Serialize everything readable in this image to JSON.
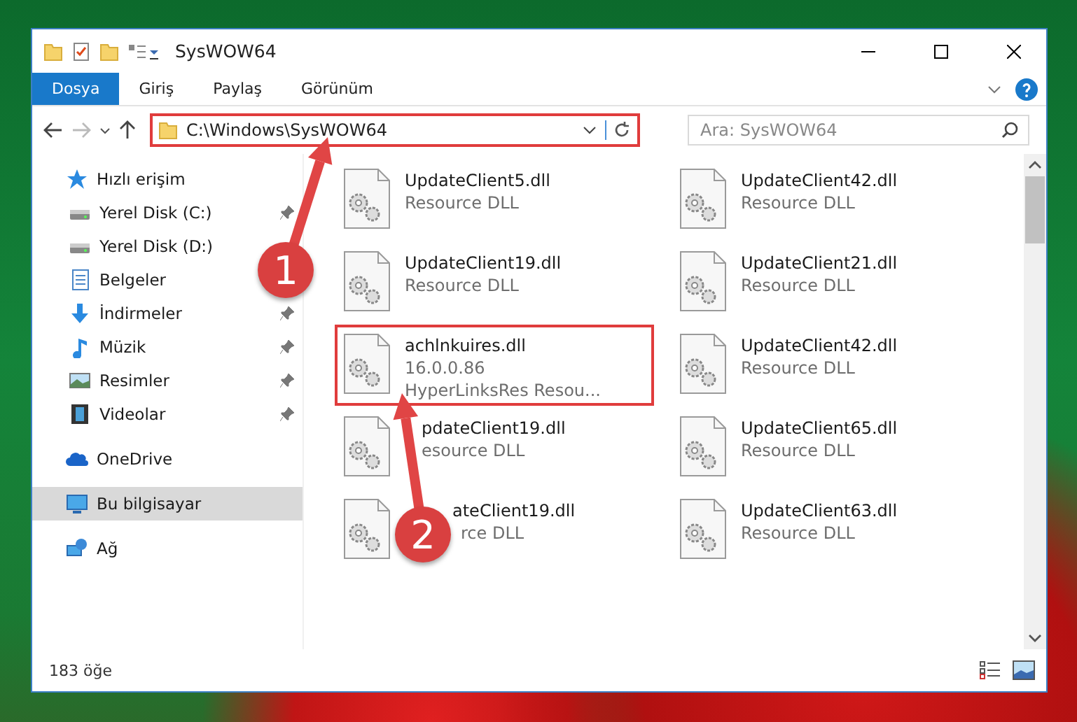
{
  "window": {
    "title": "SysWOW64"
  },
  "ribbon_tabs": [
    {
      "label": "Dosya",
      "kind": "file"
    },
    {
      "label": "Giriş",
      "kind": "tab"
    },
    {
      "label": "Paylaş",
      "kind": "tab"
    },
    {
      "label": "Görünüm",
      "kind": "tab"
    }
  ],
  "address_bar": {
    "path": "C:\\Windows\\SysWOW64",
    "highlighted": true
  },
  "search": {
    "placeholder": "Ara: SysWOW64"
  },
  "sidebar": {
    "items": [
      {
        "label": "Hızlı erişim",
        "selected": false,
        "children": [
          {
            "label": "Yerel Disk (C:)",
            "pinned": true,
            "selected": false
          },
          {
            "label": "Yerel Disk (D:)",
            "pinned": false,
            "selected": false
          },
          {
            "label": "Belgeler",
            "pinned": false,
            "selected": false
          },
          {
            "label": "İndirmeler",
            "pinned": true,
            "selected": false
          },
          {
            "label": "Müzik",
            "pinned": true,
            "selected": false
          },
          {
            "label": "Resimler",
            "pinned": true,
            "selected": false
          },
          {
            "label": "Videolar",
            "pinned": true,
            "selected": false
          }
        ]
      },
      {
        "label": "OneDrive",
        "selected": false
      },
      {
        "label": "Bu bilgisayar",
        "selected": true
      },
      {
        "label": "Ağ",
        "selected": false
      }
    ]
  },
  "files": [
    {
      "lines": [
        "UpdateClient5.dll",
        "Resource DLL"
      ],
      "highlighted": false
    },
    {
      "lines": [
        "UpdateClient42.dll",
        "Resource DLL"
      ],
      "highlighted": false
    },
    {
      "lines": [
        "UpdateClient19.dll",
        "Resource DLL"
      ],
      "highlighted": false
    },
    {
      "lines": [
        "UpdateClient21.dll",
        "Resource DLL"
      ],
      "highlighted": false
    },
    {
      "lines": [
        "achlnkuires.dll",
        "16.0.0.86",
        "HyperLinksRes Resou..."
      ],
      "highlighted": true
    },
    {
      "lines": [
        "UpdateClient42.dll",
        "Resource DLL"
      ],
      "highlighted": false
    },
    {
      "lines": [
        "pdateClient19.dll",
        "esource DLL"
      ],
      "highlighted": false
    },
    {
      "lines": [
        "UpdateClient65.dll",
        "Resource DLL"
      ],
      "highlighted": false
    },
    {
      "lines": [
        "ateClient19.dll",
        "rce DLL"
      ],
      "highlighted": false
    },
    {
      "lines": [
        "UpdateClient63.dll",
        "Resource DLL"
      ],
      "highlighted": false
    }
  ],
  "status_bar": {
    "count": "183 öğe"
  },
  "annotations": [
    {
      "label": "1"
    },
    {
      "label": "2"
    }
  ]
}
